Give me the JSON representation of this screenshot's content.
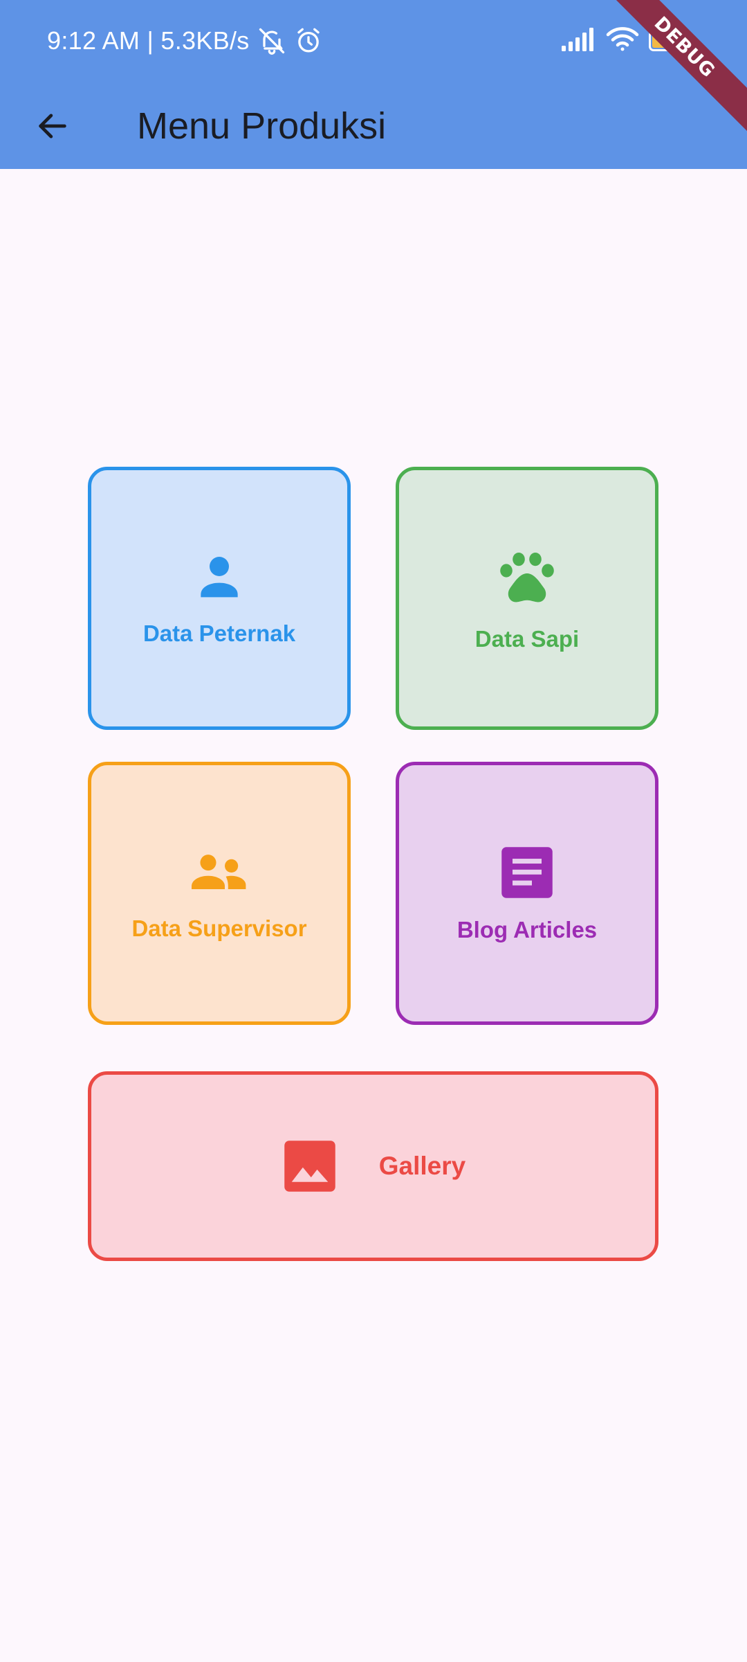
{
  "status_bar": {
    "time_text": "9:12 AM | 5.3KB/s",
    "battery_level": "68",
    "icons": [
      "bell-off-icon",
      "alarm-icon",
      "signal-icon",
      "wifi-icon",
      "battery-icon"
    ]
  },
  "app_bar": {
    "title": "Menu Produksi",
    "back_icon": "arrow-left-icon",
    "background_color": "#5E93E6"
  },
  "debug_banner": {
    "label": "DEBUG",
    "color": "#8B2E47"
  },
  "menu": {
    "items": [
      {
        "label": "Data Peternak",
        "icon": "person-icon",
        "accent": "#2A93EA",
        "background": "#D2E3FB"
      },
      {
        "label": "Data Sapi",
        "icon": "paw-icon",
        "accent": "#4CAF50",
        "background": "#DBE9DE"
      },
      {
        "label": "Data Supervisor",
        "icon": "people-icon",
        "accent": "#F6A018",
        "background": "#FDE3CE"
      },
      {
        "label": "Blog Articles",
        "icon": "article-icon",
        "accent": "#9C2CB3",
        "background": "#E8D0EF"
      },
      {
        "label": "Gallery",
        "icon": "image-icon",
        "accent": "#EB4A45",
        "background": "#FBD3DA"
      }
    ]
  }
}
